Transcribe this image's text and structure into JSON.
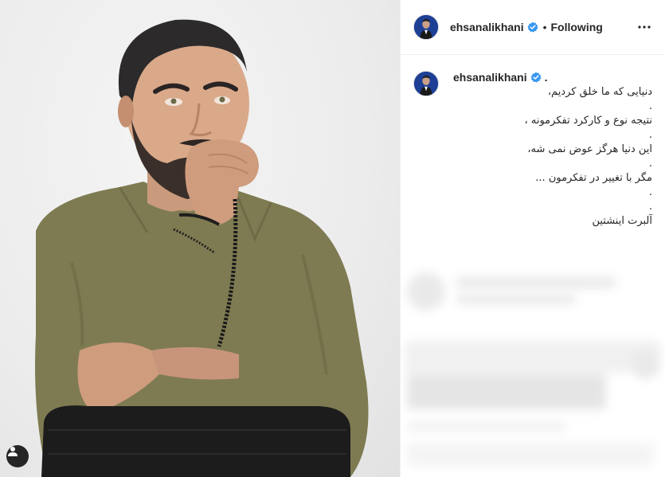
{
  "post": {
    "image_alt": "Portrait of a bearded man in an olive shirt, hand on chin, looking upward"
  },
  "header": {
    "username": "ehsanalikhani",
    "verified": true,
    "separator": "•",
    "follow_label": "Following",
    "more_icon": "more-horizontal-icon"
  },
  "caption": {
    "username": "ehsanalikhani",
    "period": ".",
    "lines": [
      "دنیایی که ما خلق کردیم،",
      ".",
      "نتیجه نوع و کارکرد تفکرمونه ،",
      ".",
      "این دنیا هرگز عوض نمی شه،",
      ".",
      "مگر با تغییر در تفکرمون ...",
      ".",
      ".",
      "آلبرت اینشتین"
    ]
  },
  "colors": {
    "verified_blue": "#3897f0",
    "shirt": "#7d7a52",
    "text": "#262626",
    "border": "#efefef"
  }
}
